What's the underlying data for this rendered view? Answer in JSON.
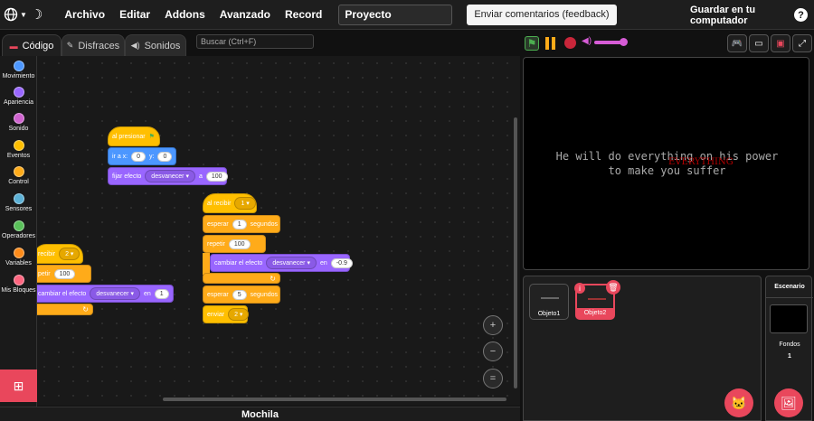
{
  "menu": {
    "items": [
      "Archivo",
      "Editar",
      "Addons",
      "Avanzado",
      "Record"
    ],
    "project_title": "Proyecto",
    "feedback": "Enviar comentarios (feedback)",
    "save": "Guardar en tu computador",
    "help": "?"
  },
  "tabs": {
    "code": "Código",
    "costumes": "Disfraces",
    "sounds": "Sonidos"
  },
  "search": {
    "placeholder": "Buscar (Ctrl+F)"
  },
  "categories": [
    {
      "label": "Movimiento",
      "color": "#4c97ff"
    },
    {
      "label": "Apariencia",
      "color": "#9966ff"
    },
    {
      "label": "Sonido",
      "color": "#cf63cf"
    },
    {
      "label": "Eventos",
      "color": "#ffbf00"
    },
    {
      "label": "Control",
      "color": "#ffab19"
    },
    {
      "label": "Sensores",
      "color": "#5cb1d6"
    },
    {
      "label": "Operadores",
      "color": "#59c059"
    },
    {
      "label": "Variables",
      "color": "#ff8c1a"
    },
    {
      "label": "Mis Bloques",
      "color": "#ff6680"
    }
  ],
  "script1": {
    "hat": "al presionar",
    "goto": "ir a x:",
    "x": "0",
    "y_label": "y:",
    "y": "0",
    "set_effect": "fijar efecto",
    "effect": "desvanecer",
    "a": "a",
    "value": "100"
  },
  "script2": {
    "hat": "al recibir",
    "msg": "1",
    "wait": "esperar",
    "wait1": "1",
    "seconds": "segundos",
    "repeat": "repetir",
    "times": "100",
    "change": "cambiar el efecto",
    "effect": "desvanecer",
    "by": "en",
    "by_value": "-0.9",
    "wait2": "5",
    "send": "enviar",
    "send_msg": "2"
  },
  "script3": {
    "hat": "recibir",
    "msg": "2",
    "repeat": "petir",
    "times": "100",
    "change": "cambiar el efecto",
    "effect": "desvanecer",
    "by": "en",
    "by_value": "1"
  },
  "zoom": {
    "in": "+",
    "out": "−",
    "reset": "="
  },
  "backpack": "Mochila",
  "stage": {
    "line1": "He will do everything on his power",
    "line2": "to make you suffer",
    "overlay": "EVERYTHING"
  },
  "sprites": [
    {
      "name": "Objeto1",
      "selected": false
    },
    {
      "name": "Objeto2",
      "selected": true
    }
  ],
  "backdrop": {
    "title": "Escenario",
    "label": "Fondos",
    "count": "1"
  },
  "colors": {
    "accent": "#e9475c",
    "volume": "#d65cd6"
  }
}
